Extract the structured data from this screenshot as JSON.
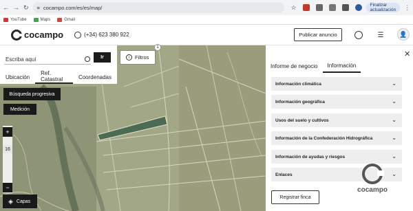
{
  "browser": {
    "url": "cocampo.com/es/es/map/",
    "update_label": "Finalizar actualización"
  },
  "bookmarks": [
    {
      "label": "YouTube",
      "color": "#e03030"
    },
    {
      "label": "Maps",
      "color": "#3aa757"
    },
    {
      "label": "Gmail",
      "color": "#d44638"
    }
  ],
  "header": {
    "logo_text": "cocampo",
    "phone": "(+34) 623 380 922",
    "publish_label": "Publicar anuncio"
  },
  "search": {
    "placeholder": "Escriba aquí",
    "go_label": "Ir",
    "tabs": [
      "Ubicación",
      "Ref. Catastral",
      "Coordenadas"
    ],
    "active_tab": "Ref. Catastral"
  },
  "map": {
    "filters_label": "Filtros",
    "filters_badge": "1",
    "progressive_search_label": "Búsqueda progresiva",
    "measure_label": "Medición",
    "zoom_in": "+",
    "zoom_out": "−",
    "zoom_level": "16",
    "layers_label": "Capas"
  },
  "panel": {
    "tabs": [
      "Informe de negocio",
      "Información"
    ],
    "active_tab": "Información",
    "sections": [
      "Información climática",
      "Información geográfica",
      "Usos del suelo y cultivos",
      "Información de la Confederación Hidrográfica",
      "Información de ayudas y riesgos",
      "Enlaces"
    ],
    "register_label": "Registrar finca",
    "watermark_text": "cocampo"
  }
}
